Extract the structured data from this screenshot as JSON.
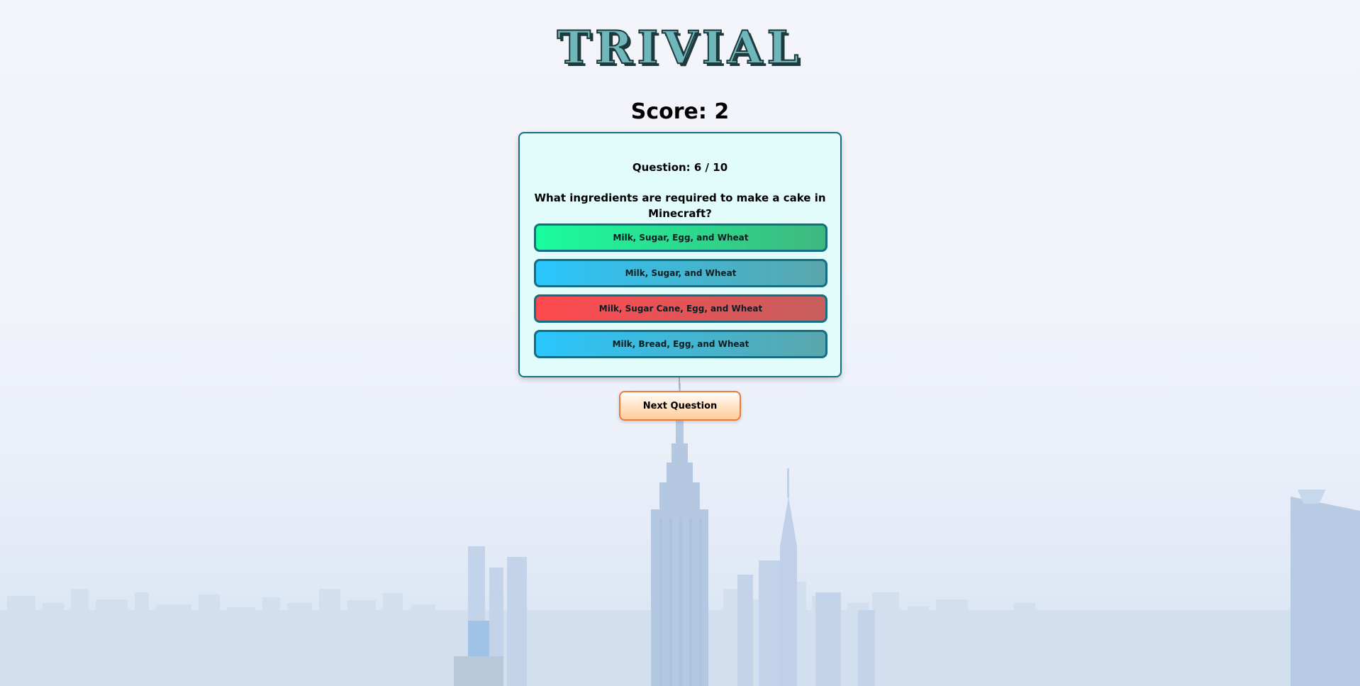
{
  "app": {
    "title": "TRIVIAL"
  },
  "score": {
    "text": "Score: 2"
  },
  "quiz": {
    "question_number": "Question: 6 / 10",
    "question_text": "What ingredients are required to make a cake in Minecraft?",
    "answers": [
      {
        "label": "Milk, Sugar, Egg, and Wheat",
        "state": "correct"
      },
      {
        "label": "Milk, Sugar, and Wheat",
        "state": "normal"
      },
      {
        "label": "Milk, Sugar Cane, Egg, and Wheat",
        "state": "wrong"
      },
      {
        "label": "Milk, Bread, Egg, and Wheat",
        "state": "normal"
      }
    ]
  },
  "controls": {
    "next_label": "Next Question"
  },
  "colors": {
    "correct": "#19fd9e",
    "normal": "#2ac6fd",
    "wrong": "#ff4a4f",
    "card_border": "#156e84",
    "next_border": "#ee7a3e"
  }
}
